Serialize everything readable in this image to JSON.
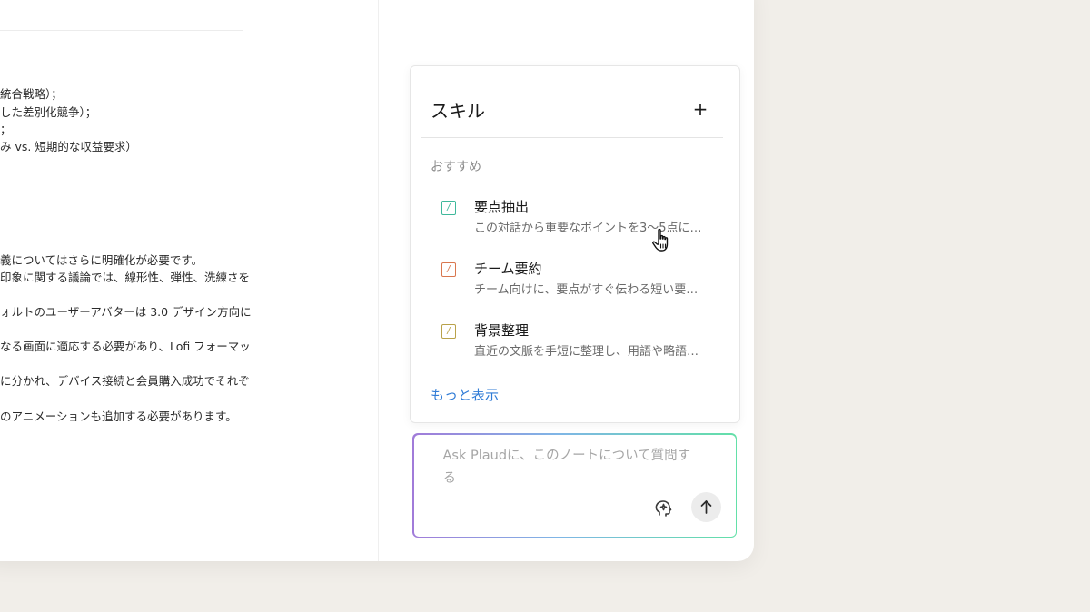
{
  "note": {
    "lines": [
      "統合戦略）；",
      "した差別化競争）；",
      "；",
      "み vs. 短期的な収益要求）",
      "義についてはさらに明確化が必要です。",
      "印象に関する議論では、線形性、弾性、洗練さを",
      "ォルトのユーザーアバターは 3.0 デザイン方向に",
      "なる画面に適応する必要があり、Lofi フォーマッ",
      "に分かれ、デバイス接続と会員購入成功でそれぞ",
      "のアニメーションも追加する必要があります。"
    ]
  },
  "skills": {
    "title": "スキル",
    "add_label": "+",
    "section_label": "おすすめ",
    "items": [
      {
        "name": "要点抽出",
        "desc": "この対話から重要なポイントを3〜5点に…",
        "icon": "skill-slash-icon",
        "color": "#3fb89b"
      },
      {
        "name": "チーム要約",
        "desc": "チーム向けに、要点がすぐ伝わる短い要…",
        "icon": "skill-slash-icon",
        "color": "#d9774f"
      },
      {
        "name": "背景整理",
        "desc": "直近の文脈を手短に整理し、用語や略語…",
        "icon": "skill-slash-icon",
        "color": "#b9a24a"
      }
    ],
    "show_more": "もっと表示"
  },
  "ask": {
    "placeholder": "Ask Plaudに、このノートについて質問する"
  },
  "icons": {
    "skills_picker": "sparkle-brain-icon",
    "send": "arrow-up-icon",
    "cursor": "hand-pointer-icon"
  }
}
